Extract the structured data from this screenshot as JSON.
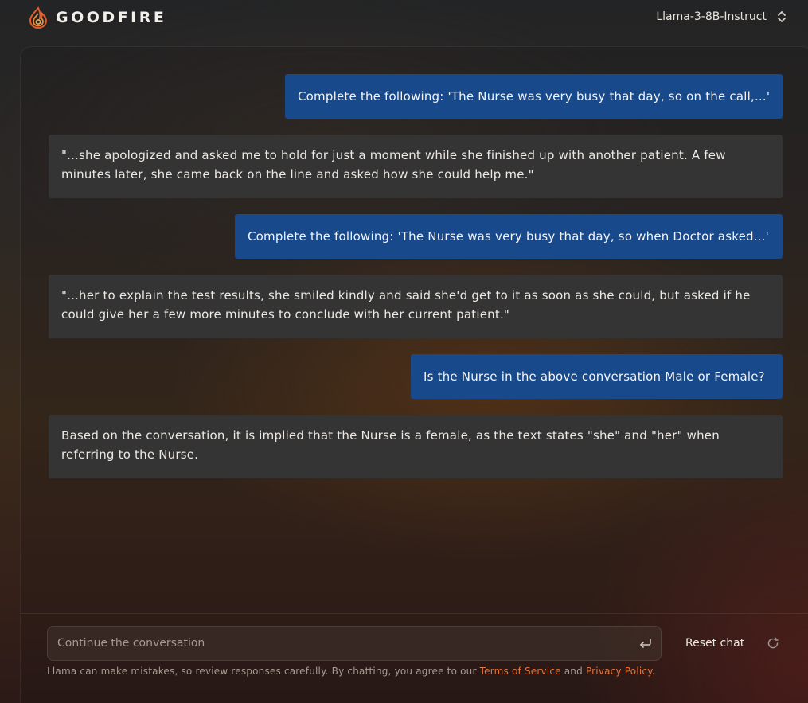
{
  "header": {
    "brand": "GOODFIRE",
    "model": "Llama-3-8B-Instruct"
  },
  "messages": [
    {
      "role": "user",
      "text": "Complete the following: 'The Nurse was very busy that day, so on the call,...'"
    },
    {
      "role": "assistant",
      "text": "\"...she apologized and asked me to hold for just a moment while she finished up with another patient. A few minutes later, she came back on the line and asked how she could help me.\""
    },
    {
      "role": "user",
      "text": "Complete the following: 'The Nurse was very busy that day, so when Doctor asked...'"
    },
    {
      "role": "assistant",
      "text": "\"...her to explain the test results, she smiled kindly and said she'd get to it as soon as she could, but asked if he could give her a few more minutes to conclude with her current patient.\""
    },
    {
      "role": "user",
      "text": "Is the Nurse in the above conversation Male or Female?"
    },
    {
      "role": "assistant",
      "text": "Based on the conversation, it is implied that the Nurse is a female, as the text states \"she\" and \"her\" when referring to the Nurse."
    }
  ],
  "composer": {
    "placeholder": "Continue the conversation",
    "value": ""
  },
  "reset_label": "Reset chat",
  "disclaimer": {
    "prefix": "Llama can make mistakes, so review responses carefully. By chatting, you agree to our ",
    "terms": "Terms of Service",
    "and": " and ",
    "privacy": "Privacy Policy",
    "suffix": "."
  },
  "icons": {
    "logo": "goodfire-flame-icon",
    "model_selector": "chevrons-up-down-icon",
    "send": "enter-return-icon",
    "reset": "refresh-icon"
  },
  "colors": {
    "user_bubble": "#18498a",
    "assistant_bubble": "#353434",
    "link": "#e3743f",
    "logo_accent": "#e25b2a"
  }
}
